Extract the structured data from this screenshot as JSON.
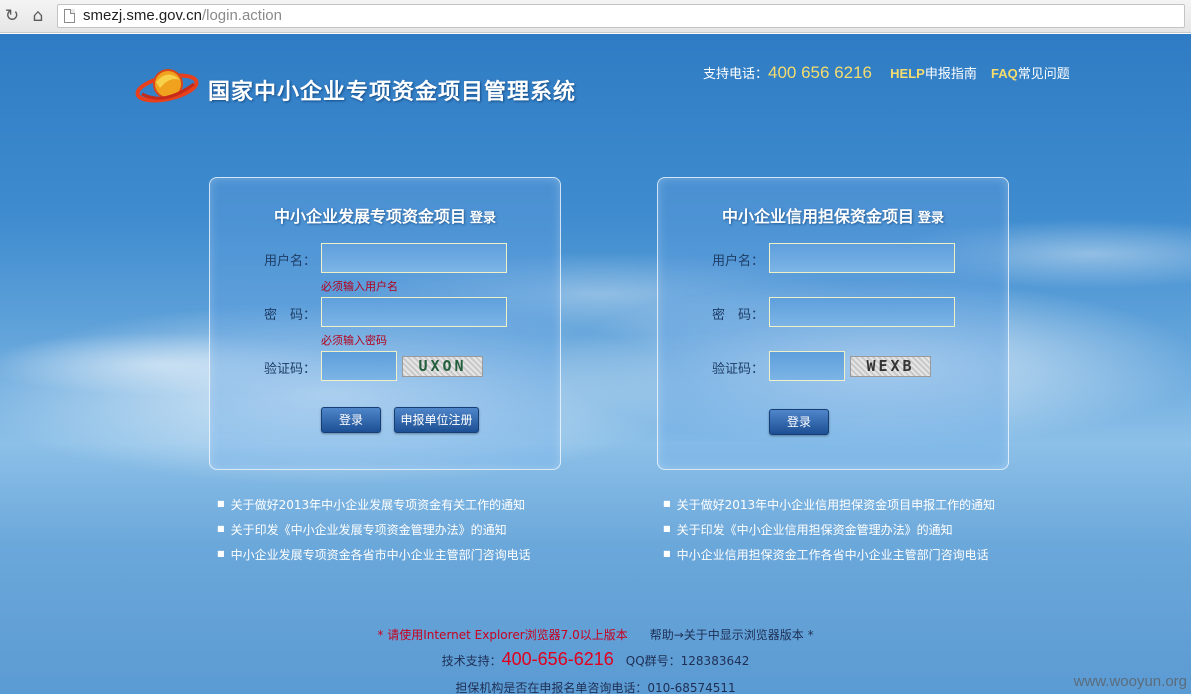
{
  "browser": {
    "url_host": "smezj.sme.gov.cn",
    "url_path": "/login.action"
  },
  "header": {
    "system_title": "国家中小企业专项资金项目管理系统",
    "support_label": "支持电话：",
    "support_phone": "400 656 6216",
    "help_kw": "HELP",
    "help_text": "申报指南",
    "faq_kw": "FAQ",
    "faq_text": "常见问题"
  },
  "left_panel": {
    "title": "中小企业发展专项资金项目",
    "title_suffix": "登录",
    "username_label": "用户名：",
    "username_error": "必须输入用户名",
    "password_label": "密　码：",
    "password_error": "必须输入密码",
    "captcha_label": "验证码：",
    "captcha_text": "UXON",
    "login_button": "登录",
    "register_button": "申报单位注册"
  },
  "right_panel": {
    "title": "中小企业信用担保资金项目",
    "title_suffix": "登录",
    "username_label": "用户名：",
    "password_label": "密　码：",
    "captcha_label": "验证码：",
    "captcha_text": "WEXB",
    "login_button": "登录"
  },
  "left_notices": [
    "关于做好2013年中小企业发展专项资金有关工作的通知",
    "关于印发《中小企业发展专项资金管理办法》的通知",
    "中小企业发展专项资金各省市中小企业主管部门咨询电话"
  ],
  "right_notices": [
    "关于做好2013年中小企业信用担保资金项目申报工作的通知",
    "关于印发《中小企业信用担保资金管理办法》的通知",
    "中小企业信用担保资金工作各省中小企业主管部门咨询电话"
  ],
  "footer": {
    "browser_notice": "* 请使用Internet Explorer浏览器7.0以上版本",
    "browser_help": "帮助→关于中显示浏览器版本 *",
    "tech_support_label": "技术支持：",
    "tech_support_phone": "400-656-6216",
    "qq_label": "QQ群号：",
    "qq_number": "128383642",
    "guarantee_line": "担保机构是否在申报名单咨询电话：010-68574511"
  },
  "watermark": "www.wooyun.org",
  "colors": {
    "sky_top": "#2f7cc4",
    "gold_accent": "#f5dc6e",
    "error_red": "#b3001b",
    "button_blue": "#1c4f94"
  }
}
